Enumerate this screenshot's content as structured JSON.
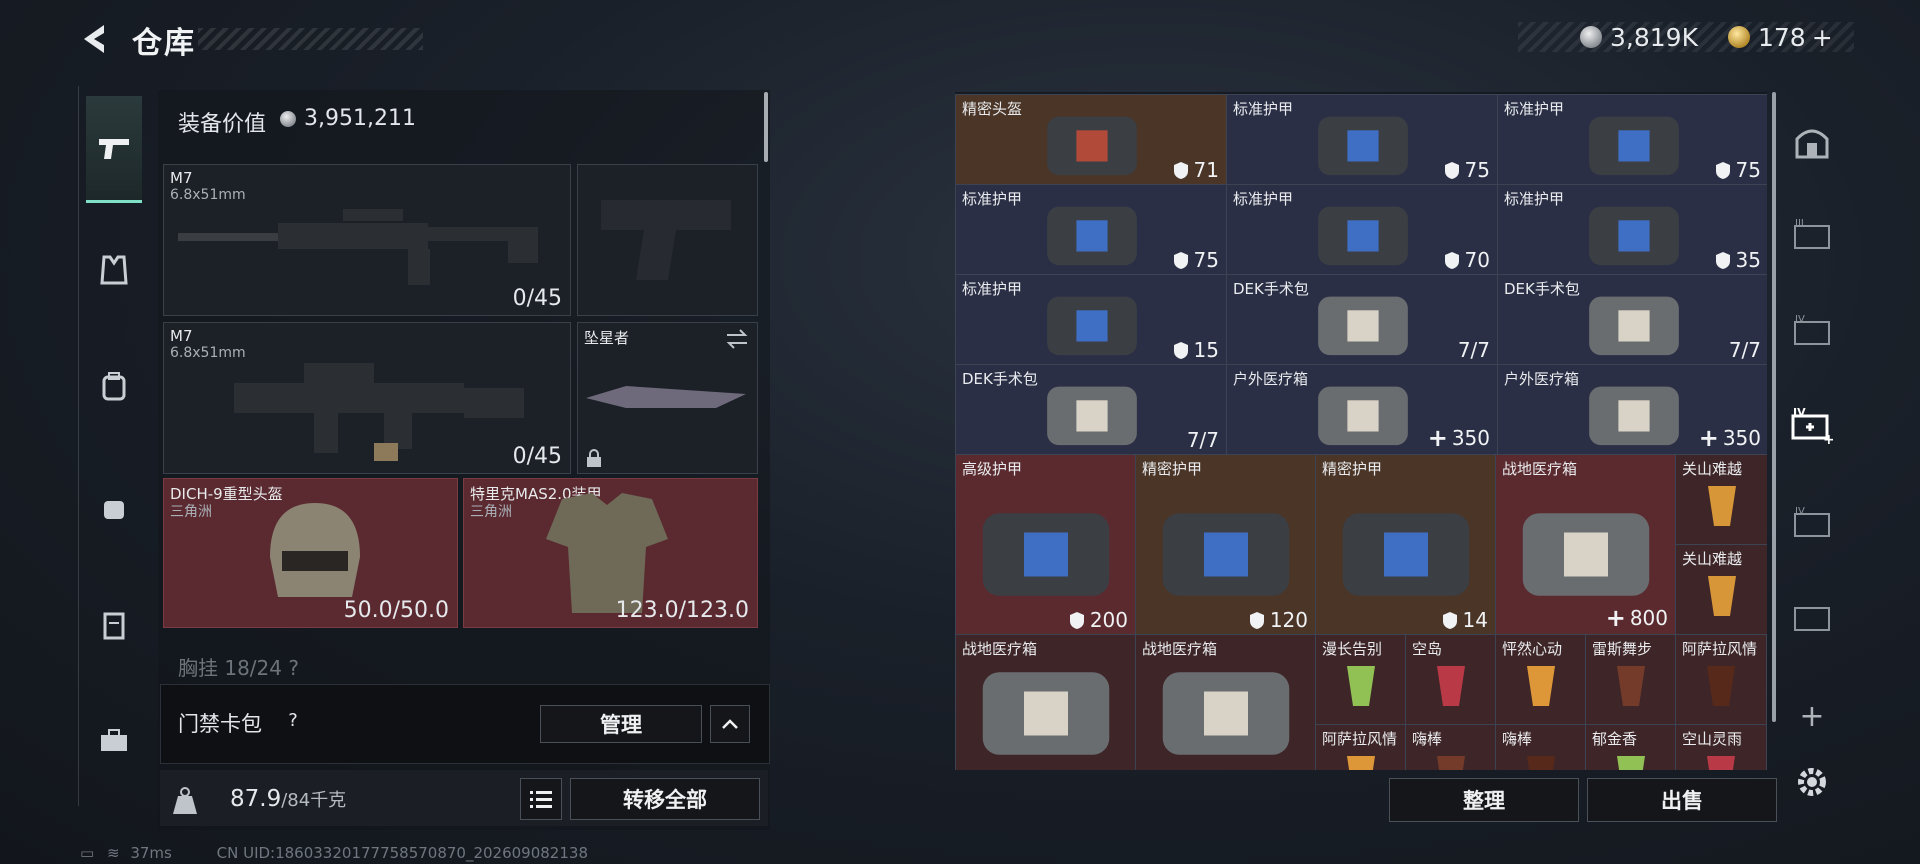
{
  "header": {
    "title": "仓库",
    "currency1": "3,819K",
    "currency2": "178",
    "currency2_plus": "+"
  },
  "equipment_value": {
    "label": "装备价值",
    "value": "3,951,211"
  },
  "slots": {
    "weapon1": {
      "name": "M7",
      "caliber": "6.8x51mm",
      "ammo": "0/45"
    },
    "weapon2": {
      "name": "M7",
      "caliber": "6.8x51mm",
      "ammo": "0/45"
    },
    "melee": {
      "name": "坠星者"
    },
    "helmet": {
      "name": "DICH-9重型头盔",
      "sub": "三角洲",
      "durability": "50.0/50.0"
    },
    "armor": {
      "name": "特里克MAS2.0装甲",
      "sub": "三角洲",
      "durability": "123.0/123.0"
    },
    "chest_rig_partial": "胸挂 18/24 ?"
  },
  "card_bag": {
    "label": "门禁卡包",
    "help": "?",
    "manage": "管理"
  },
  "weight": {
    "current": "87.9",
    "max": "/84千克",
    "transfer_all": "转移全部"
  },
  "status": {
    "ping": "37ms",
    "uid": "CN UID:18603320177758570870_202609082138"
  },
  "grid_items": [
    {
      "name": "精密头盔",
      "value": "71",
      "kind": "shield",
      "bg": "brown",
      "c": 0,
      "r": 0
    },
    {
      "name": "标准护甲",
      "value": "75",
      "kind": "shield",
      "bg": "blue",
      "c": 1,
      "r": 0
    },
    {
      "name": "标准护甲",
      "value": "75",
      "kind": "shield",
      "bg": "blue",
      "c": 2,
      "r": 0
    },
    {
      "name": "标准护甲",
      "value": "75",
      "kind": "shield",
      "bg": "blue",
      "c": 0,
      "r": 1
    },
    {
      "name": "标准护甲",
      "value": "70",
      "kind": "shield",
      "bg": "blue",
      "c": 1,
      "r": 1
    },
    {
      "name": "标准护甲",
      "value": "35",
      "kind": "shield",
      "bg": "blue",
      "c": 2,
      "r": 1
    },
    {
      "name": "标准护甲",
      "value": "15",
      "kind": "shield",
      "bg": "blue",
      "c": 0,
      "r": 2
    },
    {
      "name": "DEK手术包",
      "value": "7/7",
      "kind": "count",
      "bg": "blue",
      "c": 1,
      "r": 2
    },
    {
      "name": "DEK手术包",
      "value": "7/7",
      "kind": "count",
      "bg": "blue",
      "c": 2,
      "r": 2
    },
    {
      "name": "DEK手术包",
      "value": "7/7",
      "kind": "count",
      "bg": "blue",
      "c": 0,
      "r": 3
    },
    {
      "name": "户外医疗箱",
      "value": "350",
      "kind": "plus",
      "bg": "blue",
      "c": 1,
      "r": 3
    },
    {
      "name": "户外医疗箱",
      "value": "350",
      "kind": "plus",
      "bg": "blue",
      "c": 2,
      "r": 3
    }
  ],
  "big_items": [
    {
      "name": "高级护甲",
      "value": "200",
      "kind": "shield",
      "bg": "red"
    },
    {
      "name": "精密护甲",
      "value": "120",
      "kind": "shield",
      "bg": "brown"
    },
    {
      "name": "精密护甲",
      "value": "14",
      "kind": "shield",
      "bg": "brown"
    },
    {
      "name": "战地医疗箱",
      "value": "800",
      "kind": "plus",
      "bg": "red"
    }
  ],
  "drinks_side": [
    {
      "name": "关山难越"
    },
    {
      "name": "关山难越"
    }
  ],
  "bottom_big": [
    {
      "name": "战地医疗箱"
    },
    {
      "name": "战地医疗箱"
    }
  ],
  "drinks_row1": [
    {
      "name": "漫长告别"
    },
    {
      "name": "空岛"
    },
    {
      "name": "怦然心动"
    },
    {
      "name": "雷斯舞步"
    },
    {
      "name": "阿萨拉风情"
    }
  ],
  "drinks_row2": [
    {
      "name": "阿萨拉风情"
    },
    {
      "name": "嗨棒"
    },
    {
      "name": "嗨棒"
    },
    {
      "name": "郁金香"
    },
    {
      "name": "空山灵雨"
    }
  ],
  "buttons": {
    "organize": "整理",
    "sell": "出售"
  }
}
